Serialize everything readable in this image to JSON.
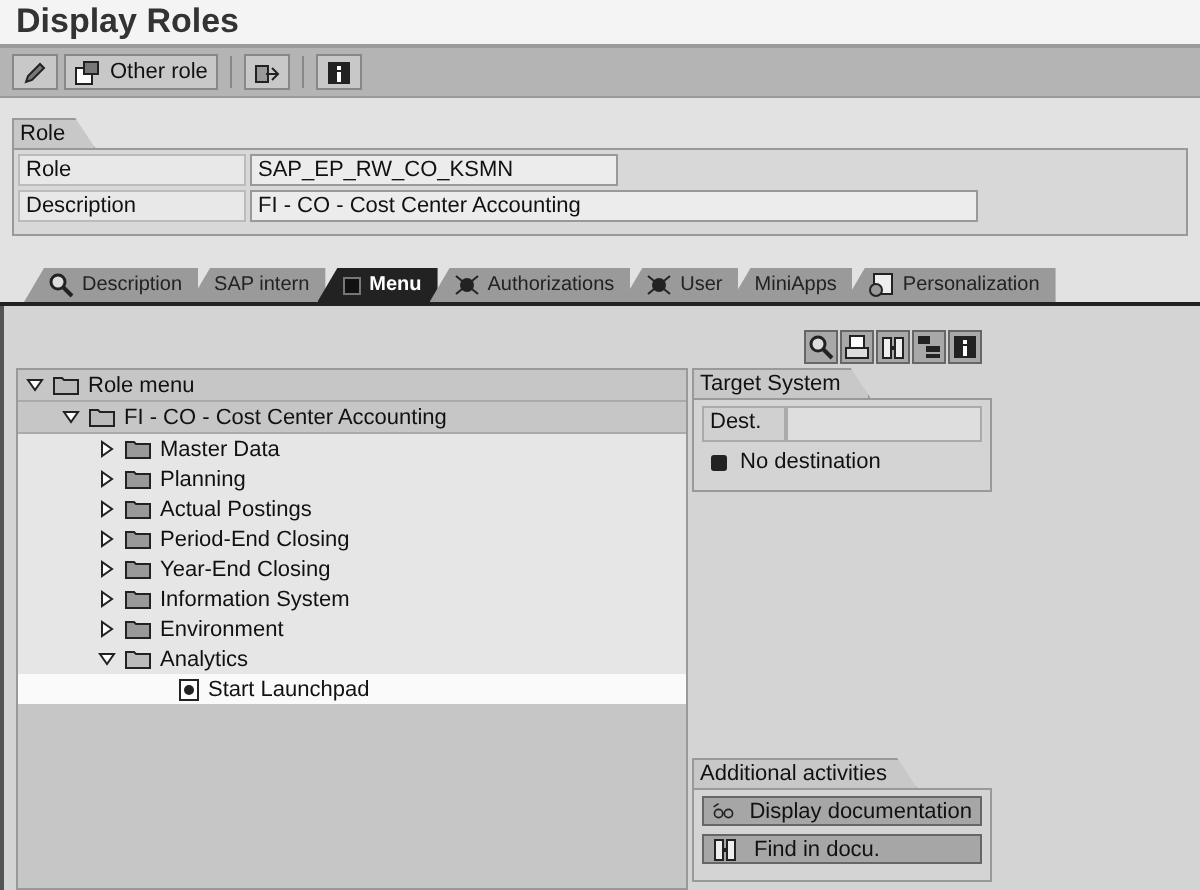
{
  "title": "Display Roles",
  "toolbar": [
    {
      "kind": "icon"
    },
    {
      "kind": "labeled",
      "label": "Other role"
    },
    {
      "kind": "separator"
    },
    {
      "kind": "icon"
    },
    {
      "kind": "separator"
    },
    {
      "kind": "icon"
    }
  ],
  "role_group": {
    "title": "Role",
    "fields": [
      {
        "label": "Role",
        "value": "SAP_EP_RW_CO_KSMN"
      },
      {
        "label": "Description",
        "value": "FI - CO - Cost Center Accounting"
      }
    ]
  },
  "tabs": [
    {
      "label": "Description",
      "selected": false
    },
    {
      "label": "SAP intern",
      "selected": false
    },
    {
      "label": "Menu",
      "selected": true
    },
    {
      "label": "Authorizations",
      "selected": false
    },
    {
      "label": "User",
      "selected": false
    },
    {
      "label": "MiniApps",
      "selected": false
    },
    {
      "label": "Personalization",
      "selected": false
    }
  ],
  "tree": {
    "label": "Role menu",
    "expanded": true,
    "selected": false,
    "children": [
      {
        "label": "FI - CO - Cost Center Accounting",
        "expanded": true,
        "selected": false,
        "children": [
          {
            "label": "Master Data",
            "expanded": false,
            "selected": false
          },
          {
            "label": "Planning",
            "expanded": false,
            "selected": false
          },
          {
            "label": "Actual Postings",
            "expanded": false,
            "selected": false
          },
          {
            "label": "Period-End Closing",
            "expanded": false,
            "selected": false
          },
          {
            "label": "Year-End Closing",
            "expanded": false,
            "selected": false
          },
          {
            "label": "Information System",
            "expanded": false,
            "selected": false
          },
          {
            "label": "Environment",
            "expanded": false,
            "selected": false
          },
          {
            "label": "Analytics",
            "expanded": true,
            "selected": false,
            "children": [
              {
                "label": "Start Launchpad",
                "kind": "transaction",
                "selected": true
              }
            ]
          }
        ]
      }
    ]
  },
  "target_system": {
    "title": "Target System",
    "field_label": "Dest.",
    "status": "No destination"
  },
  "additional_activities": {
    "title": "Additional activities",
    "buttons": [
      {
        "label": "Display documentation"
      },
      {
        "label": "Find in docu."
      }
    ]
  }
}
